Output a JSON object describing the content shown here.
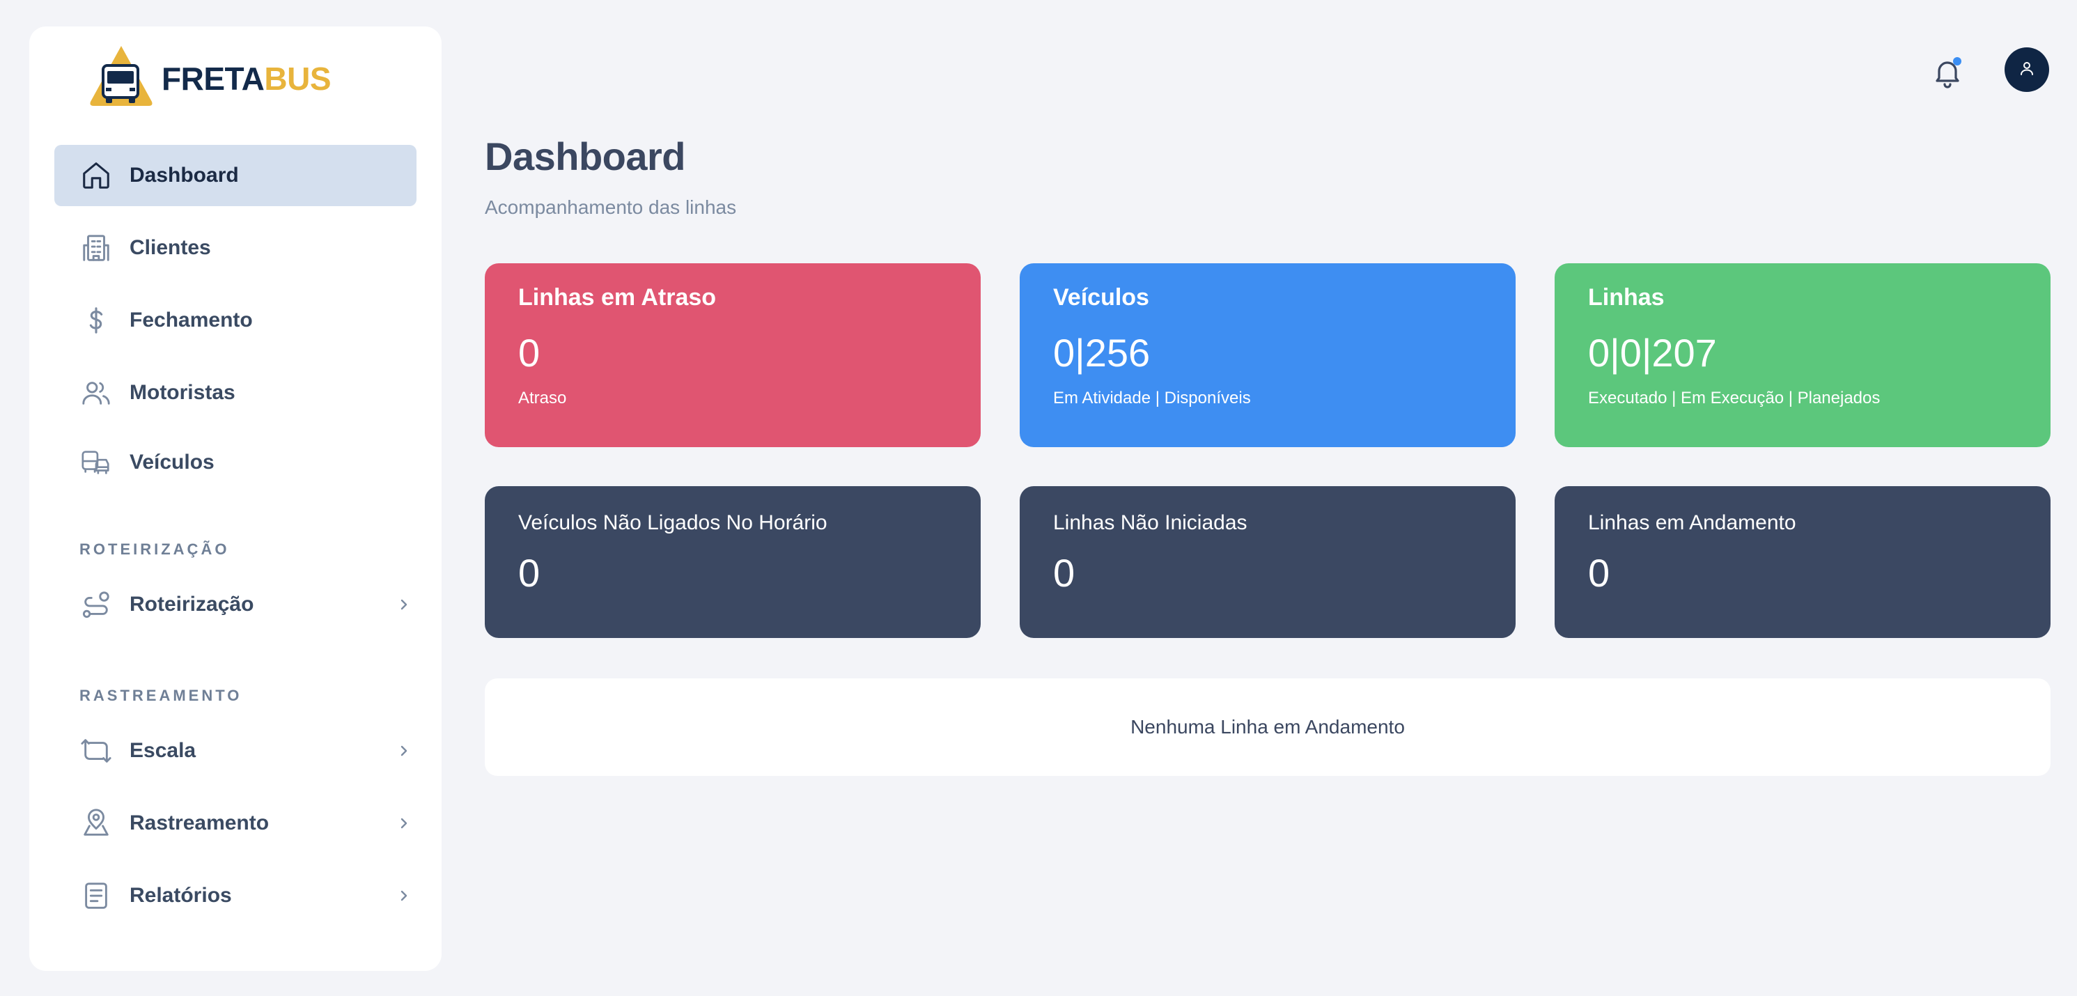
{
  "colors": {
    "card_red": "#e05571",
    "card_blue": "#3e8ef2",
    "card_green": "#5cc77c",
    "card_dark": "#3b4862",
    "nav_active_bg": "#d4dfee",
    "brand_dark": "#132a4a",
    "brand_gold": "#e8b43c"
  },
  "brand": {
    "part1": "FRETA",
    "part2": "BUS",
    "logo_icon": "bus-logo-icon"
  },
  "sidebar": {
    "items": [
      {
        "label": "Dashboard",
        "icon": "home-icon",
        "active": true
      },
      {
        "label": "Clientes",
        "icon": "building-icon"
      },
      {
        "label": "Fechamento",
        "icon": "dollar-icon"
      },
      {
        "label": "Motoristas",
        "icon": "users-icon"
      },
      {
        "label": "Veículos",
        "icon": "vehicles-icon"
      }
    ],
    "sections": [
      {
        "title": "ROTEIRIZAÇÃO",
        "items": [
          {
            "label": "Roteirização",
            "icon": "route-icon",
            "has_children": true
          }
        ]
      },
      {
        "title": "RASTREAMENTO",
        "items": [
          {
            "label": "Escala",
            "icon": "repeat-icon",
            "has_children": true
          },
          {
            "label": "Rastreamento",
            "icon": "map-pin-icon",
            "has_children": true
          },
          {
            "label": "Relatórios",
            "icon": "document-icon",
            "has_children": true
          }
        ]
      }
    ]
  },
  "header": {
    "bell_icon": "bell-icon",
    "avatar_icon": "user-icon"
  },
  "main": {
    "title": "Dashboard",
    "subtitle": "Acompanhamento das linhas",
    "top_cards": [
      {
        "title": "Linhas em Atraso",
        "value": "0",
        "subtitle": "Atraso"
      },
      {
        "title": "Veículos",
        "value": "0|256",
        "subtitle": "Em Atividade | Disponíveis"
      },
      {
        "title": "Linhas",
        "value": "0|0|207",
        "subtitle": "Executado | Em Execução | Planejados"
      }
    ],
    "bottom_cards": [
      {
        "title": "Veículos Não Ligados No Horário",
        "value": "0"
      },
      {
        "title": "Linhas Não Iniciadas",
        "value": "0"
      },
      {
        "title": "Linhas em Andamento",
        "value": "0"
      }
    ],
    "empty_message": "Nenhuma Linha em Andamento"
  }
}
